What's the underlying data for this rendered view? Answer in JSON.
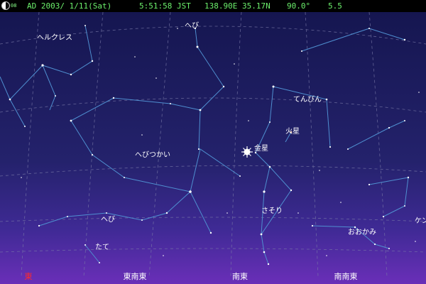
{
  "status": {
    "moon_icon": "moon-phase-icon",
    "moon_age": "08",
    "date": "AD 2003/ 1/11(Sat)",
    "time": "5:51:58 JST",
    "location": "138.90E 35.17N",
    "fov": "90.0°",
    "mag_limit": "5.5"
  },
  "sky_labels": {
    "hercules": "ヘルクレス",
    "serpens_caput": "へび",
    "libra": "てんびん",
    "mars": "火星",
    "venus": "金星",
    "ophiuchus": "へびつかい",
    "scorpius": "さそり",
    "serpens_cauda": "へび",
    "scutum": "たて",
    "lupus": "おおかみ",
    "centaurus": "ケン"
  },
  "compass": {
    "east": "東",
    "ese": "東南東",
    "se": "南東",
    "sse": "南南東"
  },
  "colors": {
    "sky_top": "#151650",
    "sky_bottom": "#6a2fb8",
    "constellation_line": "#4f8fd0",
    "grid_line": "#7a7aa8",
    "status_text": "#6cf06c",
    "east_label": "#ff2a2a"
  }
}
